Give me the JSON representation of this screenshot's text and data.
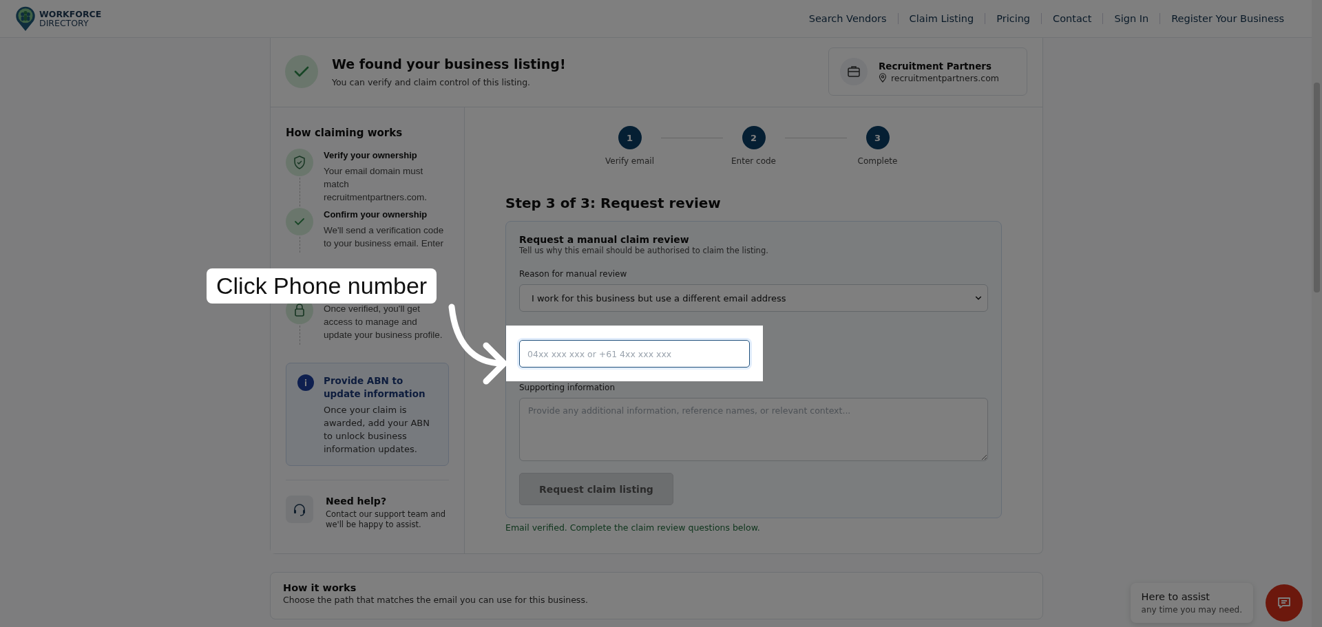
{
  "header": {
    "logo": {
      "line1": "WORKFORCE",
      "line2": "DIRECTORY"
    },
    "nav": [
      {
        "label": "Search Vendors"
      },
      {
        "label": "Claim Listing"
      },
      {
        "label": "Pricing"
      },
      {
        "label": "Contact"
      },
      {
        "label": "Sign In"
      },
      {
        "label": "Register Your Business"
      }
    ]
  },
  "found": {
    "title": "We found your business listing!",
    "subtitle": "You can verify and claim control of this listing.",
    "business": {
      "name": "Recruitment Partners",
      "website": "recruitmentpartners.com"
    }
  },
  "sidebar": {
    "title": "How claiming works",
    "items": [
      {
        "kind": "shield",
        "title": "Verify your ownership",
        "text": "Your email domain must match recruitmentpartners.com."
      },
      {
        "kind": "check",
        "title": "Confirm your ownership",
        "text": "We'll send a verification code to your business email. Enter"
      },
      {
        "kind": "lock",
        "text": "Once verified, you'll get access to manage and update your business profile."
      }
    ],
    "notice": {
      "title": "Provide ABN to update information",
      "text": "Once your claim is awarded, add your ABN to unlock business information updates."
    },
    "help": {
      "title": "Need help?",
      "text": "Contact our support team and we'll be happy to assist."
    }
  },
  "steps": [
    {
      "number": "1",
      "label": "Verify email"
    },
    {
      "number": "2",
      "label": "Enter code"
    },
    {
      "number": "3",
      "label": "Complete"
    }
  ],
  "form": {
    "heading": "Step 3 of 3: Request review",
    "title": "Request a manual claim review",
    "subtitle": "Tell us why this email should be authorised to claim the listing.",
    "reason": {
      "label": "Reason for manual review",
      "value": "I work for this business but use a different email address"
    },
    "phone": {
      "placeholder": "04xx xxx xxx or +61 4xx xxx xxx",
      "focused": true
    },
    "supporting": {
      "label": "Supporting information",
      "placeholder": "Provide any additional information, reference names, or relevant context..."
    },
    "submit": {
      "label": "Request claim listing",
      "disabled": true
    },
    "status": "Email verified. Complete the claim review questions below."
  },
  "how_it_works": {
    "title": "How it works",
    "text": "Choose the path that matches the email you can use for this business."
  },
  "chat": {
    "title": "Here to assist",
    "text": "any time you may need."
  },
  "callout": {
    "text": "Click Phone number"
  }
}
